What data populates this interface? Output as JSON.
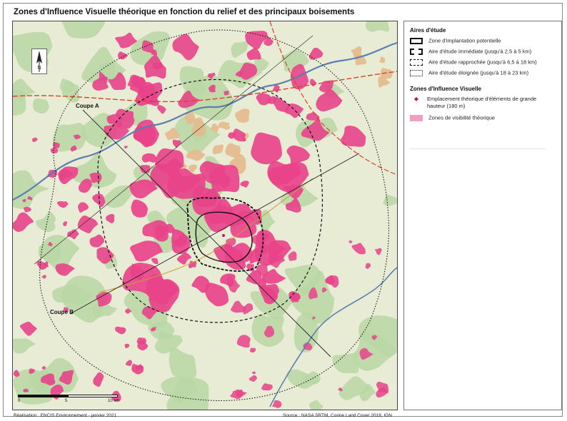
{
  "title": "Zones d'Influence Visuelle théorique en fonction du relief et des principaux boisements",
  "map": {
    "coupe_a": "Coupe A",
    "coupe_b": "Coupe B",
    "north_letter": "N",
    "scale": {
      "zero": "0",
      "mid": "5",
      "end": "10 km"
    }
  },
  "legend": {
    "study_heading": "Aires d'étude",
    "study_items": [
      {
        "label": "Zone d'implantation potentielle",
        "style": "solid-bold"
      },
      {
        "label": "Aire d'étude immédiate (jusqu'à 2,5 à 5 km)",
        "style": "dashed-bold"
      },
      {
        "label": "Aire d'étude rapprochée (jusqu'à 6,5 à 18 km)",
        "style": "dashed"
      },
      {
        "label": "Aire d'étude éloignée (jusqu'à 18 à 23 km)",
        "style": "dotted"
      }
    ],
    "zone_heading": "Zones d'Influence Visuelle",
    "zone_items": [
      {
        "label": "Emplacement théorique d'éléments de grande hauteur (180 m)",
        "kind": "point"
      },
      {
        "label": "Zones de visibilité théorique",
        "kind": "fill"
      }
    ]
  },
  "credits": {
    "left": "Réalisation : ENCIS Environnement - janvier 2021",
    "right": "Source : NASA SRTM, Corine Land Cover 2018, IGN"
  },
  "colors": {
    "visibility": "#e8438a",
    "visibility_legend": "#f29fc2",
    "forest": "#b9d7a4",
    "land": "#e9ecd4",
    "urban": "#e5b98c",
    "river": "#5a7fb0",
    "road": "#d4442b"
  }
}
